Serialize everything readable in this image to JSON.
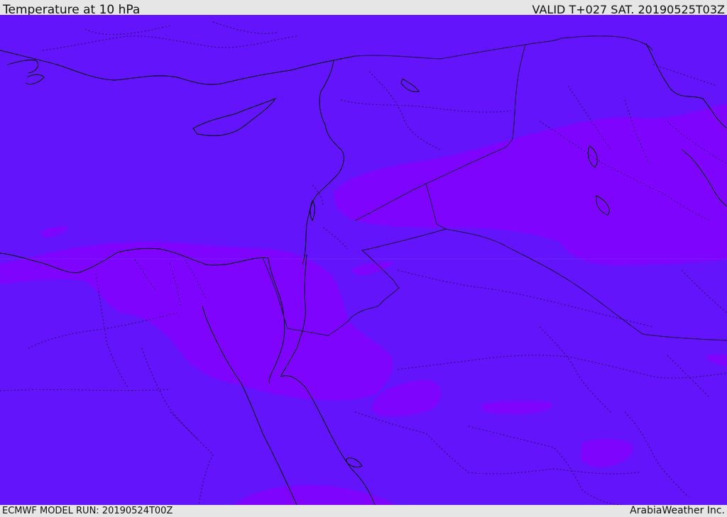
{
  "header": {
    "title": "Temperature at 10 hPa",
    "valid_time": "VALID T+027 SAT. 20190525T03Z"
  },
  "footer": {
    "model_run": "ECMWF MODEL RUN: 20190524T00Z",
    "credit": "ArabiaWeather Inc."
  },
  "map": {
    "field": "temperature",
    "pressure_level_hpa": 10,
    "colors": {
      "base_fill": "#6414fa",
      "warm_fill": "#8000ff",
      "warm_fill_alt": "#7a08fc",
      "coastline": "#000000",
      "border": "#1a0a40"
    }
  }
}
